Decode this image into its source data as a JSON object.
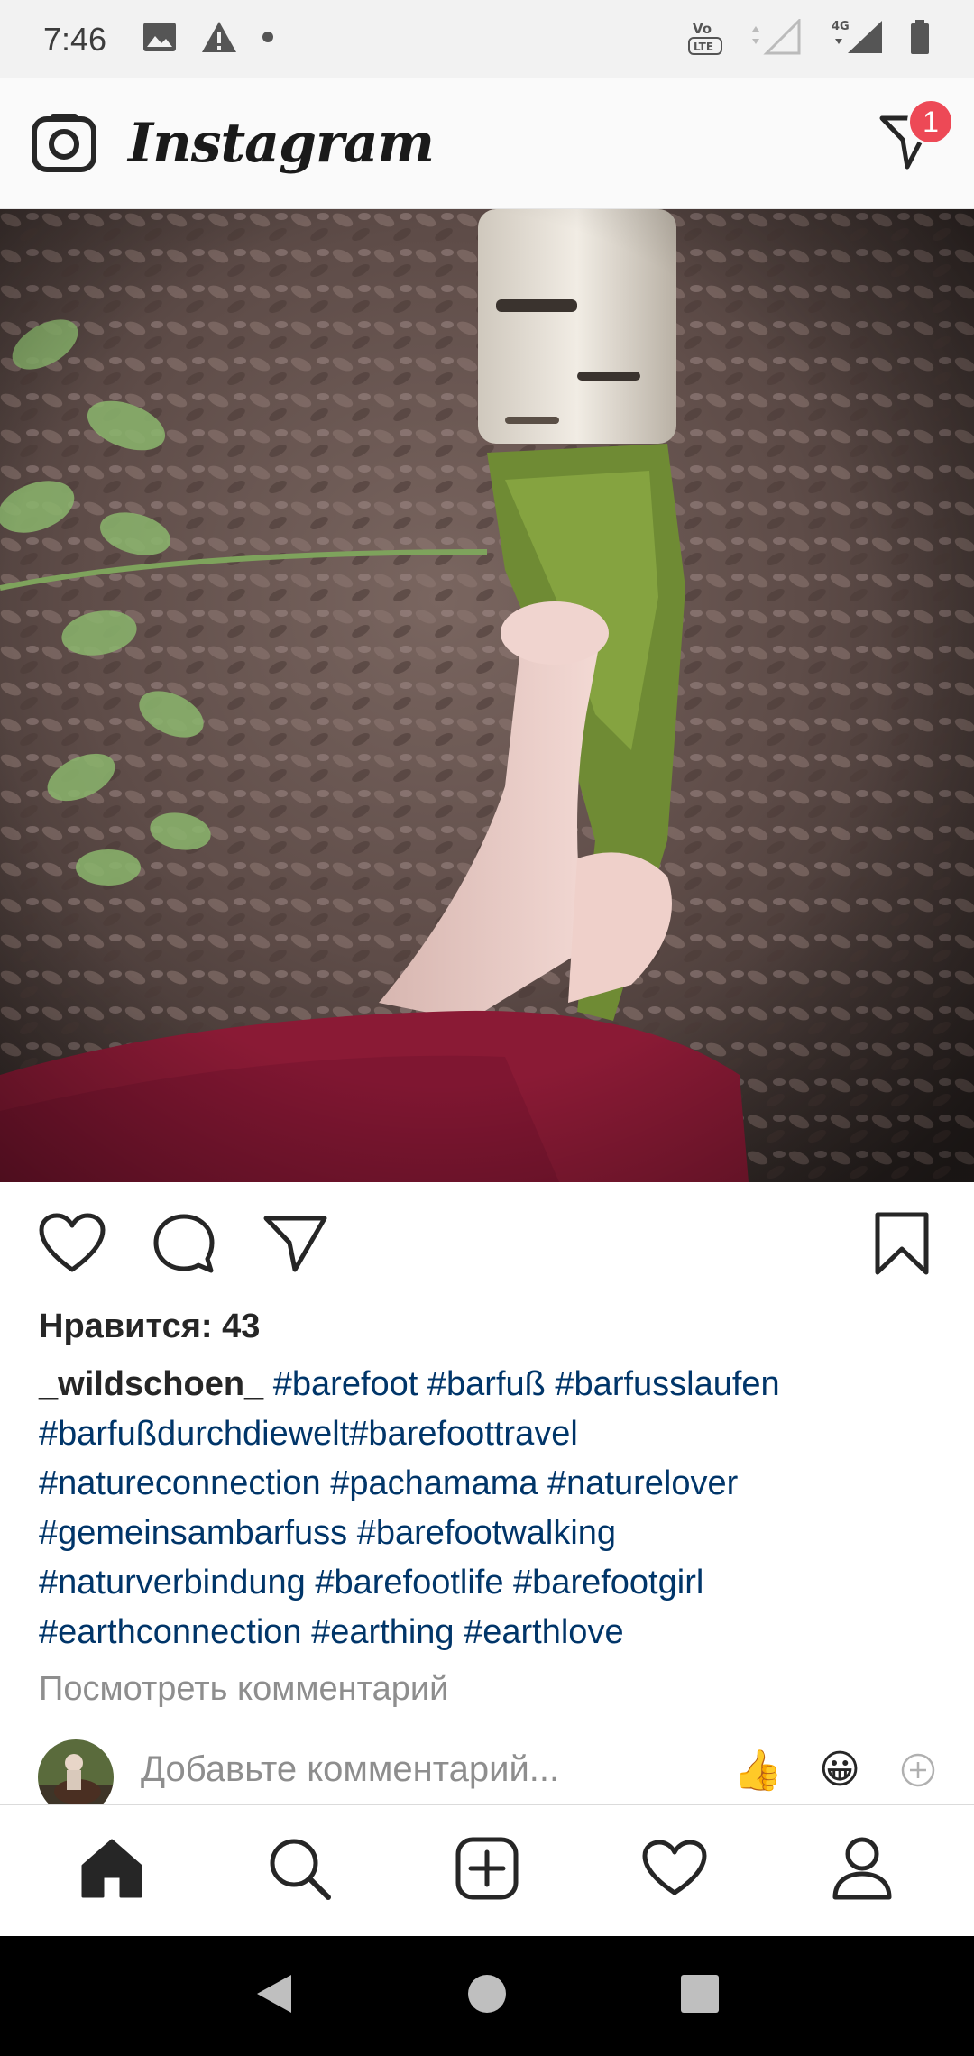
{
  "status_bar": {
    "time": "7:46",
    "left_icons": [
      "image-icon",
      "warning-icon",
      "dot-icon"
    ],
    "right_icons": [
      "volte-icon",
      "signal-icon",
      "4g-signal-icon",
      "battery-icon"
    ],
    "network_label": "4G",
    "volte_label": "VoLTE"
  },
  "header": {
    "app_name": "Instagram",
    "dm_badge_count": "1"
  },
  "post": {
    "image_description_icon": "post-photo",
    "likes": "Нравится: 43",
    "username": "_wildschoen_",
    "hashtags_line1": "#barefoot #barfuß #barfusslaufen",
    "hashtags_line2": "#barfußdurchdiewelt#barefoottravel",
    "hashtags_line3": "#natureconnection #pachamama #naturelover",
    "hashtags_line4": "#gemeinsambarfuss #barefootwalking",
    "hashtags_line5": "#naturverbindung #barefootlife #barefootgirl",
    "hashtags_line6": "#earthconnection #earthing #earthlove",
    "view_comments": "Посмотреть комментарий"
  },
  "comment_box": {
    "placeholder": "Добавьте комментарий...",
    "emoji_1": "👍",
    "emoji_2": "😀"
  },
  "colors": {
    "accent_badge": "#ed4956",
    "hashtag": "#003569",
    "muted": "#8e8e8e"
  }
}
